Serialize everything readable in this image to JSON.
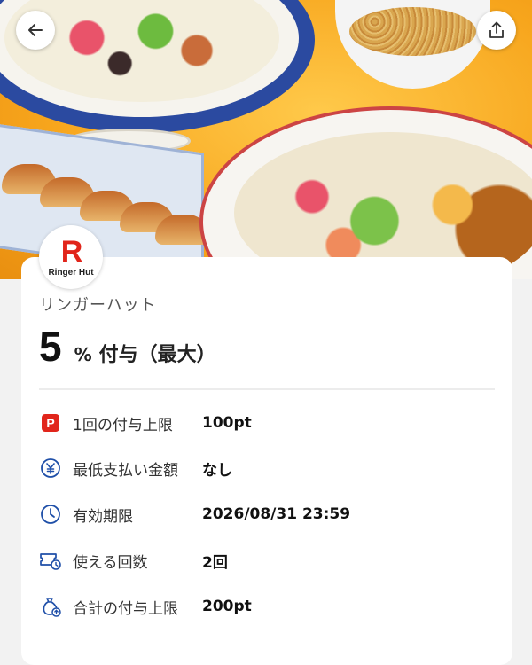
{
  "header": {
    "back_icon": "arrow-left-icon",
    "share_icon": "share-upload-icon"
  },
  "store": {
    "logo_text": "Ringer Hut",
    "logo_mark": "R",
    "name": "リンガーハット"
  },
  "reward": {
    "rate_value": "5",
    "rate_unit": "%",
    "rate_text": "付与（最大）"
  },
  "details": [
    {
      "icon": "paypay-icon",
      "label": "1回の付与上限",
      "value": "100pt"
    },
    {
      "icon": "yen-icon",
      "label": "最低支払い金額",
      "value": "なし"
    },
    {
      "icon": "clock-icon",
      "label": "有効期限",
      "value": "2026/08/31 23:59"
    },
    {
      "icon": "ticket-icon",
      "label": "使える回数",
      "value": "2回"
    },
    {
      "icon": "money-bag-icon",
      "label": "合計の付与上限",
      "value": "200pt"
    }
  ],
  "colors": {
    "brand_red": "#e1251b",
    "icon_blue": "#1f4fa8",
    "background": "#f2f2f2"
  }
}
